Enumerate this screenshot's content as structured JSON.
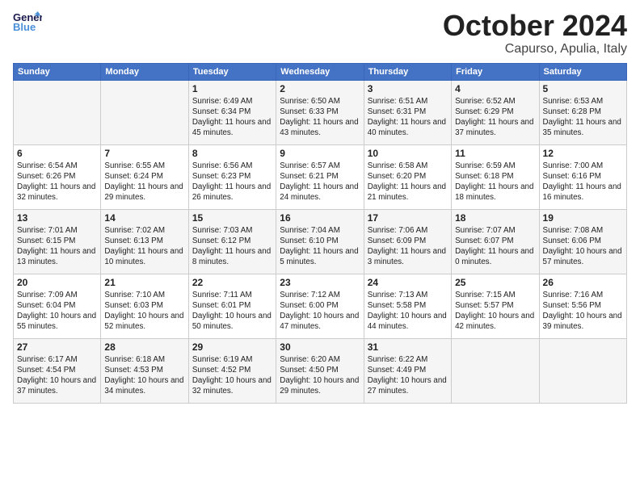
{
  "logo": {
    "line1": "General",
    "line2": "Blue"
  },
  "title": "October 2024",
  "subtitle": "Capurso, Apulia, Italy",
  "days_of_week": [
    "Sunday",
    "Monday",
    "Tuesday",
    "Wednesday",
    "Thursday",
    "Friday",
    "Saturday"
  ],
  "weeks": [
    [
      {
        "day": "",
        "info": ""
      },
      {
        "day": "",
        "info": ""
      },
      {
        "day": "1",
        "info": "Sunrise: 6:49 AM\nSunset: 6:34 PM\nDaylight: 11 hours and 45 minutes."
      },
      {
        "day": "2",
        "info": "Sunrise: 6:50 AM\nSunset: 6:33 PM\nDaylight: 11 hours and 43 minutes."
      },
      {
        "day": "3",
        "info": "Sunrise: 6:51 AM\nSunset: 6:31 PM\nDaylight: 11 hours and 40 minutes."
      },
      {
        "day": "4",
        "info": "Sunrise: 6:52 AM\nSunset: 6:29 PM\nDaylight: 11 hours and 37 minutes."
      },
      {
        "day": "5",
        "info": "Sunrise: 6:53 AM\nSunset: 6:28 PM\nDaylight: 11 hours and 35 minutes."
      }
    ],
    [
      {
        "day": "6",
        "info": "Sunrise: 6:54 AM\nSunset: 6:26 PM\nDaylight: 11 hours and 32 minutes."
      },
      {
        "day": "7",
        "info": "Sunrise: 6:55 AM\nSunset: 6:24 PM\nDaylight: 11 hours and 29 minutes."
      },
      {
        "day": "8",
        "info": "Sunrise: 6:56 AM\nSunset: 6:23 PM\nDaylight: 11 hours and 26 minutes."
      },
      {
        "day": "9",
        "info": "Sunrise: 6:57 AM\nSunset: 6:21 PM\nDaylight: 11 hours and 24 minutes."
      },
      {
        "day": "10",
        "info": "Sunrise: 6:58 AM\nSunset: 6:20 PM\nDaylight: 11 hours and 21 minutes."
      },
      {
        "day": "11",
        "info": "Sunrise: 6:59 AM\nSunset: 6:18 PM\nDaylight: 11 hours and 18 minutes."
      },
      {
        "day": "12",
        "info": "Sunrise: 7:00 AM\nSunset: 6:16 PM\nDaylight: 11 hours and 16 minutes."
      }
    ],
    [
      {
        "day": "13",
        "info": "Sunrise: 7:01 AM\nSunset: 6:15 PM\nDaylight: 11 hours and 13 minutes."
      },
      {
        "day": "14",
        "info": "Sunrise: 7:02 AM\nSunset: 6:13 PM\nDaylight: 11 hours and 10 minutes."
      },
      {
        "day": "15",
        "info": "Sunrise: 7:03 AM\nSunset: 6:12 PM\nDaylight: 11 hours and 8 minutes."
      },
      {
        "day": "16",
        "info": "Sunrise: 7:04 AM\nSunset: 6:10 PM\nDaylight: 11 hours and 5 minutes."
      },
      {
        "day": "17",
        "info": "Sunrise: 7:06 AM\nSunset: 6:09 PM\nDaylight: 11 hours and 3 minutes."
      },
      {
        "day": "18",
        "info": "Sunrise: 7:07 AM\nSunset: 6:07 PM\nDaylight: 11 hours and 0 minutes."
      },
      {
        "day": "19",
        "info": "Sunrise: 7:08 AM\nSunset: 6:06 PM\nDaylight: 10 hours and 57 minutes."
      }
    ],
    [
      {
        "day": "20",
        "info": "Sunrise: 7:09 AM\nSunset: 6:04 PM\nDaylight: 10 hours and 55 minutes."
      },
      {
        "day": "21",
        "info": "Sunrise: 7:10 AM\nSunset: 6:03 PM\nDaylight: 10 hours and 52 minutes."
      },
      {
        "day": "22",
        "info": "Sunrise: 7:11 AM\nSunset: 6:01 PM\nDaylight: 10 hours and 50 minutes."
      },
      {
        "day": "23",
        "info": "Sunrise: 7:12 AM\nSunset: 6:00 PM\nDaylight: 10 hours and 47 minutes."
      },
      {
        "day": "24",
        "info": "Sunrise: 7:13 AM\nSunset: 5:58 PM\nDaylight: 10 hours and 44 minutes."
      },
      {
        "day": "25",
        "info": "Sunrise: 7:15 AM\nSunset: 5:57 PM\nDaylight: 10 hours and 42 minutes."
      },
      {
        "day": "26",
        "info": "Sunrise: 7:16 AM\nSunset: 5:56 PM\nDaylight: 10 hours and 39 minutes."
      }
    ],
    [
      {
        "day": "27",
        "info": "Sunrise: 6:17 AM\nSunset: 4:54 PM\nDaylight: 10 hours and 37 minutes."
      },
      {
        "day": "28",
        "info": "Sunrise: 6:18 AM\nSunset: 4:53 PM\nDaylight: 10 hours and 34 minutes."
      },
      {
        "day": "29",
        "info": "Sunrise: 6:19 AM\nSunset: 4:52 PM\nDaylight: 10 hours and 32 minutes."
      },
      {
        "day": "30",
        "info": "Sunrise: 6:20 AM\nSunset: 4:50 PM\nDaylight: 10 hours and 29 minutes."
      },
      {
        "day": "31",
        "info": "Sunrise: 6:22 AM\nSunset: 4:49 PM\nDaylight: 10 hours and 27 minutes."
      },
      {
        "day": "",
        "info": ""
      },
      {
        "day": "",
        "info": ""
      }
    ]
  ]
}
